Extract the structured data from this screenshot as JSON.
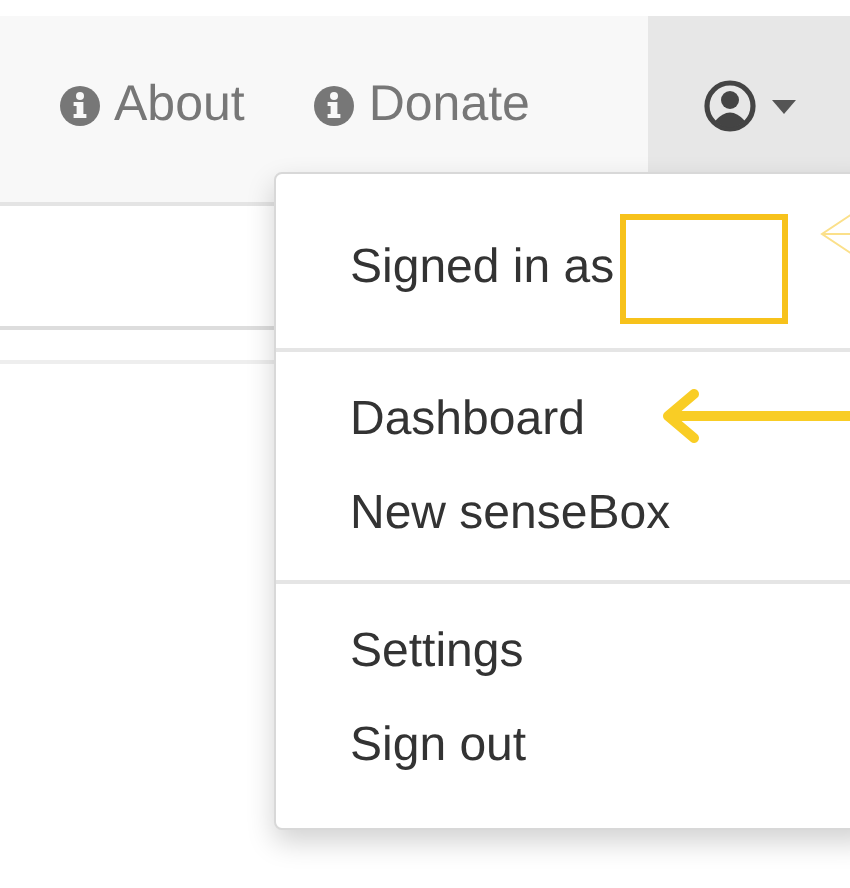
{
  "navbar": {
    "links": [
      {
        "label": "About"
      },
      {
        "label": "Donate"
      }
    ],
    "user_menu": {
      "expanded": true
    }
  },
  "dropdown": {
    "sections": [
      [
        {
          "kind": "header",
          "label": "Signed in as"
        }
      ],
      [
        {
          "kind": "item",
          "label": "Dashboard"
        },
        {
          "kind": "item",
          "label": "New senseBox"
        }
      ],
      [
        {
          "kind": "item",
          "label": "Settings"
        },
        {
          "kind": "item",
          "label": "Sign out"
        }
      ]
    ]
  }
}
